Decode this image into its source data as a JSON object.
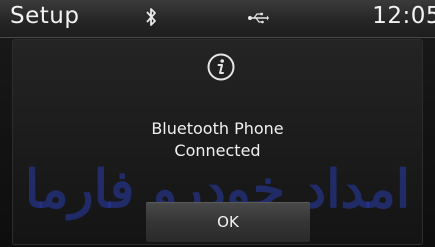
{
  "status_bar": {
    "title": "Setup",
    "time": "12:05",
    "icons": [
      "bluetooth-icon",
      "usb-icon"
    ]
  },
  "popup": {
    "icon": "info-icon",
    "message_line1": "Bluetooth Phone",
    "message_line2": "Connected",
    "ok_label": "OK"
  },
  "watermark": {
    "text": "امداد خودرو فارما"
  },
  "colors": {
    "background": "#121212",
    "status_bar": "#2a2a2a",
    "text": "#f2f2f2",
    "button": "#3a3a3a",
    "watermark": "#283caa"
  }
}
